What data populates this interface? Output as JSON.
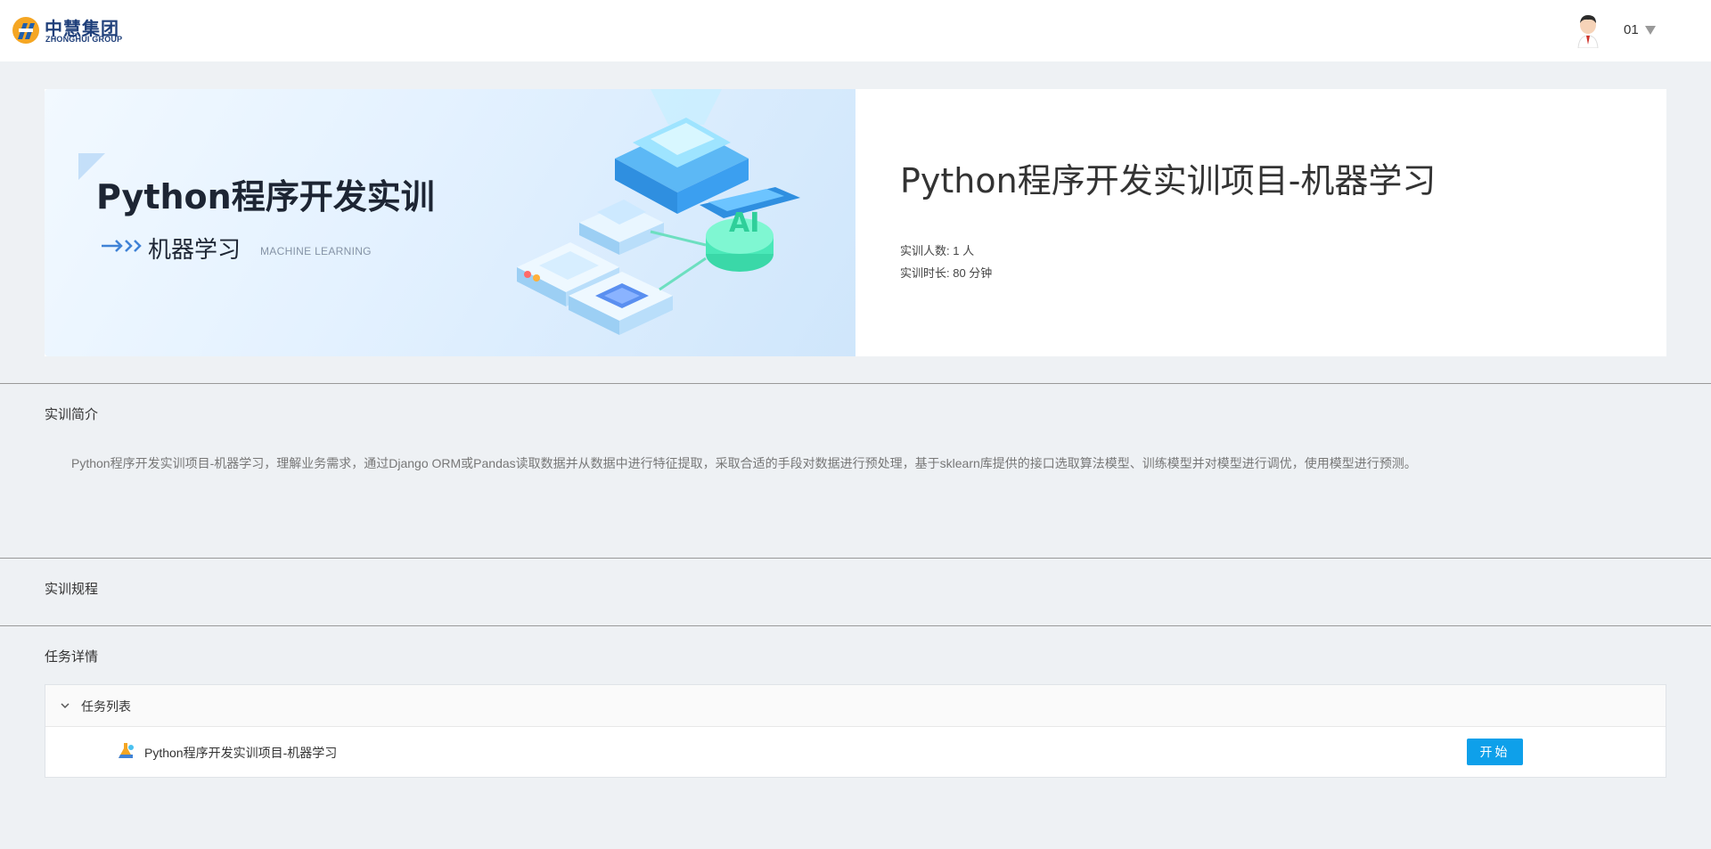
{
  "header": {
    "logo_cn": "中慧集团",
    "logo_en": "ZHONGHUI GROUP",
    "username": "01"
  },
  "hero": {
    "banner_title": "Python程序开发实训",
    "banner_subtitle": "机器学习",
    "banner_subtitle_en": "MACHINE LEARNING",
    "course_title": "Python程序开发实训项目-机器学习",
    "people_label": "实训人数: ",
    "people_value": "1 人",
    "duration_label": "实训时长: ",
    "duration_value": "80 分钟"
  },
  "sections": {
    "intro_title": "实训简介",
    "intro_text": "Python程序开发实训项目-机器学习，理解业务需求，通过Django ORM或Pandas读取数据并从数据中进行特征提取，采取合适的手段对数据进行预处理，基于sklearn库提供的接口选取算法模型、训练模型并对模型进行调优，使用模型进行预测。",
    "rules_title": "实训规程",
    "tasks_title": "任务详情"
  },
  "tasks": {
    "list_label": "任务列表",
    "items": [
      {
        "name": "Python程序开发实训项目-机器学习",
        "action": "开始"
      }
    ]
  },
  "colors": {
    "accent": "#0ea0ea",
    "background": "#eef1f4",
    "logo_blue": "#1f3f7a"
  },
  "icons": [
    "logo-mark-icon",
    "avatar",
    "caret-down-icon",
    "arrow-right-icon",
    "chevron-down-icon",
    "task-flask-icon"
  ]
}
